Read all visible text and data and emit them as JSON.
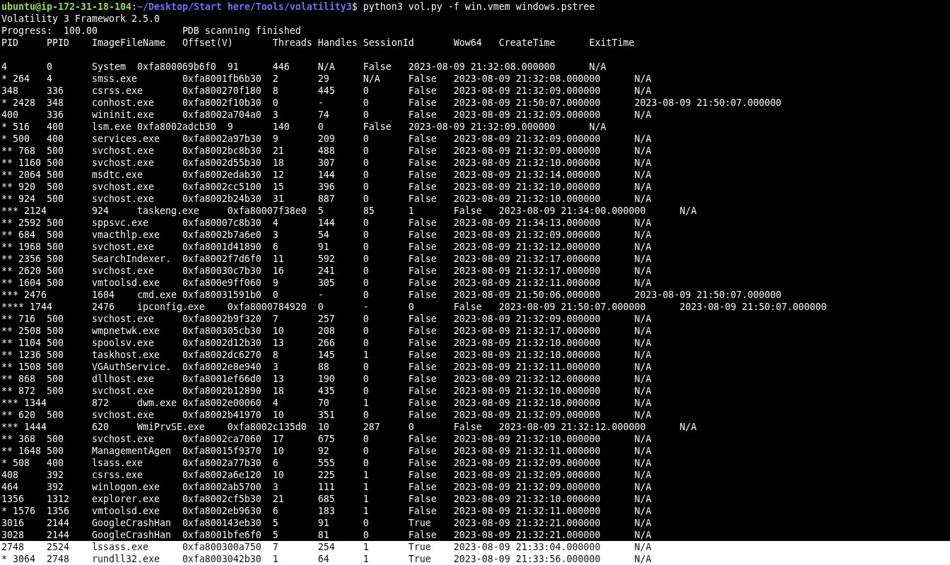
{
  "prompt": {
    "user_host": "ubuntu@ip-172-31-18-104",
    "separator": ":",
    "path": "~/Desktop/Start here/Tools/volatility3",
    "command": "$ python3 vol.py -f win.vmem windows.pstree"
  },
  "banner": "Volatility 3 Framework 2.5.0",
  "progress": [
    "Progress:  100.00",
    "PDB scanning finished"
  ],
  "header": [
    "PID",
    "PPID",
    "ImageFileName",
    "Offset(V)",
    "Threads",
    "Handles",
    "SessionId",
    "Wow64",
    "CreateTime",
    "ExitTime"
  ],
  "rows": [
    {
      "cells": [
        "4",
        "0",
        "System",
        "0xfa800069b6f0",
        "91",
        "446",
        "N/A",
        "False",
        "2023-08-09 21:32:08.000000",
        "N/A"
      ],
      "highlighted": false
    },
    {
      "cells": [
        "* 264",
        "4",
        "smss.exe",
        "0xfa8001fb6b30",
        "2",
        "29",
        "N/A",
        "False",
        "2023-08-09 21:32:08.000000",
        "N/A"
      ],
      "highlighted": false
    },
    {
      "cells": [
        "348",
        "336",
        "csrss.exe",
        "0xfa800270f180",
        "8",
        "445",
        "0",
        "False",
        "2023-08-09 21:32:09.000000",
        "N/A"
      ],
      "highlighted": false
    },
    {
      "cells": [
        "* 2428",
        "348",
        "conhost.exe",
        "0xfa8002f10b30",
        "0",
        "-",
        "0",
        "False",
        "2023-08-09 21:50:07.000000",
        "2023-08-09 21:50:07.000000"
      ],
      "highlighted": false
    },
    {
      "cells": [
        "400",
        "336",
        "wininit.exe",
        "0xfa8002a704a0",
        "3",
        "74",
        "0",
        "False",
        "2023-08-09 21:32:09.000000",
        "N/A"
      ],
      "highlighted": false
    },
    {
      "cells": [
        "* 516",
        "400",
        "lsm.exe",
        "0xfa8002adcb30",
        "9",
        "140",
        "0",
        "False",
        "2023-08-09 21:32:09.000000",
        "N/A"
      ],
      "highlighted": false
    },
    {
      "cells": [
        "* 500",
        "400",
        "services.exe",
        "0xfa8002a97b30",
        "9",
        "209",
        "0",
        "False",
        "2023-08-09 21:32:09.000000",
        "N/A"
      ],
      "highlighted": false
    },
    {
      "cells": [
        "** 768",
        "500",
        "svchost.exe",
        "0xfa8002bc8b30",
        "21",
        "488",
        "0",
        "False",
        "2023-08-09 21:32:09.000000",
        "N/A"
      ],
      "highlighted": false
    },
    {
      "cells": [
        "** 1160",
        "500",
        "svchost.exe",
        "0xfa8002d55b30",
        "18",
        "307",
        "0",
        "False",
        "2023-08-09 21:32:10.000000",
        "N/A"
      ],
      "highlighted": false
    },
    {
      "cells": [
        "** 2064",
        "500",
        "msdtc.exe",
        "0xfa8002edab30",
        "12",
        "144",
        "0",
        "False",
        "2023-08-09 21:32:14.000000",
        "N/A"
      ],
      "highlighted": false
    },
    {
      "cells": [
        "** 920",
        "500",
        "svchost.exe",
        "0xfa8002cc5100",
        "15",
        "396",
        "0",
        "False",
        "2023-08-09 21:32:10.000000",
        "N/A"
      ],
      "highlighted": false
    },
    {
      "cells": [
        "** 924",
        "500",
        "svchost.exe",
        "0xfa8002b24b30",
        "31",
        "887",
        "0",
        "False",
        "2023-08-09 21:32:10.000000",
        "N/A"
      ],
      "highlighted": false
    },
    {
      "cells": [
        "*** 2124",
        "924",
        "taskeng.exe",
        "0xfa80007f38e0",
        "5",
        "85",
        "1",
        "False",
        "2023-08-09 21:34:00.000000",
        "N/A"
      ],
      "highlighted": false
    },
    {
      "cells": [
        "** 2592",
        "500",
        "sppsvc.exe",
        "0xfa80007c8b30",
        "4",
        "144",
        "0",
        "False",
        "2023-08-09 21:34:13.000000",
        "N/A"
      ],
      "highlighted": false
    },
    {
      "cells": [
        "** 684",
        "500",
        "vmacthlp.exe",
        "0xfa8002b7a6e0",
        "3",
        "54",
        "0",
        "False",
        "2023-08-09 21:32:09.000000",
        "N/A"
      ],
      "highlighted": false
    },
    {
      "cells": [
        "** 1968",
        "500",
        "svchost.exe",
        "0xfa8001d41890",
        "6",
        "91",
        "0",
        "False",
        "2023-08-09 21:32:12.000000",
        "N/A"
      ],
      "highlighted": false
    },
    {
      "cells": [
        "** 2356",
        "500",
        "SearchIndexer.",
        "0xfa8002f7d6f0",
        "11",
        "592",
        "0",
        "False",
        "2023-08-09 21:32:17.000000",
        "N/A"
      ],
      "highlighted": false
    },
    {
      "cells": [
        "** 2620",
        "500",
        "svchost.exe",
        "0xfa80030c7b30",
        "16",
        "241",
        "0",
        "False",
        "2023-08-09 21:32:17.000000",
        "N/A"
      ],
      "highlighted": false
    },
    {
      "cells": [
        "** 1604",
        "500",
        "vmtoolsd.exe",
        "0xfa800e9ff060",
        "9",
        "305",
        "0",
        "False",
        "2023-08-09 21:32:11.000000",
        "N/A"
      ],
      "highlighted": false
    },
    {
      "cells": [
        "*** 2476",
        "1604",
        "cmd.exe",
        "0xfa80031591b0",
        "0",
        "-",
        "0",
        "False",
        "2023-08-09 21:50:06.000000",
        "2023-08-09 21:50:07.000000"
      ],
      "highlighted": false
    },
    {
      "cells": [
        "**** 1744",
        "2476",
        "ipconfig.exe",
        "0xfa8000784920",
        "0",
        "-",
        "0",
        "False",
        "2023-08-09 21:50:07.000000",
        "2023-08-09 21:50:07.000000"
      ],
      "highlighted": false
    },
    {
      "cells": [
        "** 716",
        "500",
        "svchost.exe",
        "0xfa8002b9f320",
        "7",
        "257",
        "0",
        "False",
        "2023-08-09 21:32:09.000000",
        "N/A"
      ],
      "highlighted": false
    },
    {
      "cells": [
        "** 2508",
        "500",
        "wmpnetwk.exe",
        "0xfa800305cb30",
        "10",
        "208",
        "0",
        "False",
        "2023-08-09 21:32:17.000000",
        "N/A"
      ],
      "highlighted": false
    },
    {
      "cells": [
        "** 1104",
        "500",
        "spoolsv.exe",
        "0xfa8002d12b30",
        "13",
        "266",
        "0",
        "False",
        "2023-08-09 21:32:10.000000",
        "N/A"
      ],
      "highlighted": false
    },
    {
      "cells": [
        "** 1236",
        "500",
        "taskhost.exe",
        "0xfa8002dc6270",
        "8",
        "145",
        "1",
        "False",
        "2023-08-09 21:32:10.000000",
        "N/A"
      ],
      "highlighted": false
    },
    {
      "cells": [
        "** 1508",
        "500",
        "VGAuthService.",
        "0xfa8002e8e940",
        "3",
        "88",
        "0",
        "False",
        "2023-08-09 21:32:11.000000",
        "N/A"
      ],
      "highlighted": false
    },
    {
      "cells": [
        "** 868",
        "500",
        "dllhost.exe",
        "0xfa8001ef66d0",
        "13",
        "190",
        "0",
        "False",
        "2023-08-09 21:32:12.000000",
        "N/A"
      ],
      "highlighted": false
    },
    {
      "cells": [
        "** 872",
        "500",
        "svchost.exe",
        "0xfa8002b12890",
        "18",
        "435",
        "0",
        "False",
        "2023-08-09 21:32:10.000000",
        "N/A"
      ],
      "highlighted": false
    },
    {
      "cells": [
        "*** 1344",
        "872",
        "dwm.exe",
        "0xfa8002e00060",
        "4",
        "70",
        "1",
        "False",
        "2023-08-09 21:32:10.000000",
        "N/A"
      ],
      "highlighted": false
    },
    {
      "cells": [
        "** 620",
        "500",
        "svchost.exe",
        "0xfa8002b41970",
        "10",
        "351",
        "0",
        "False",
        "2023-08-09 21:32:09.000000",
        "N/A"
      ],
      "highlighted": false
    },
    {
      "cells": [
        "*** 1444",
        "620",
        "WmiPrvSE.exe",
        "0xfa8002c135d0",
        "10",
        "287",
        "0",
        "False",
        "2023-08-09 21:32:12.000000",
        "N/A"
      ],
      "highlighted": false
    },
    {
      "cells": [
        "** 368",
        "500",
        "svchost.exe",
        "0xfa8002ca7060",
        "17",
        "675",
        "0",
        "False",
        "2023-08-09 21:32:10.000000",
        "N/A"
      ],
      "highlighted": false
    },
    {
      "cells": [
        "** 1648",
        "500",
        "ManagementAgen",
        "0xfa80015f9370",
        "10",
        "92",
        "0",
        "False",
        "2023-08-09 21:32:11.000000",
        "N/A"
      ],
      "highlighted": false
    },
    {
      "cells": [
        "* 508",
        "400",
        "lsass.exe",
        "0xfa8002a77b30",
        "6",
        "555",
        "0",
        "False",
        "2023-08-09 21:32:09.000000",
        "N/A"
      ],
      "highlighted": false
    },
    {
      "cells": [
        "408",
        "392",
        "csrss.exe",
        "0xfa8002a6e120",
        "10",
        "225",
        "1",
        "False",
        "2023-08-09 21:32:09.000000",
        "N/A"
      ],
      "highlighted": false
    },
    {
      "cells": [
        "464",
        "392",
        "winlogon.exe",
        "0xfa8002ab5700",
        "3",
        "111",
        "1",
        "False",
        "2023-08-09 21:32:09.000000",
        "N/A"
      ],
      "highlighted": false
    },
    {
      "cells": [
        "1356",
        "1312",
        "explorer.exe",
        "0xfa8002cf5b30",
        "21",
        "685",
        "1",
        "False",
        "2023-08-09 21:32:10.000000",
        "N/A"
      ],
      "highlighted": false
    },
    {
      "cells": [
        "* 1576",
        "1356",
        "vmtoolsd.exe",
        "0xfa8002eb9630",
        "6",
        "183",
        "1",
        "False",
        "2023-08-09 21:32:11.000000",
        "N/A"
      ],
      "highlighted": false
    },
    {
      "cells": [
        "3016",
        "2144",
        "GoogleCrashHan",
        "0xfa800143eb30",
        "5",
        "91",
        "0",
        "True",
        "2023-08-09 21:32:21.000000",
        "N/A"
      ],
      "highlighted": false
    },
    {
      "cells": [
        "3028",
        "2144",
        "GoogleCrashHan",
        "0xfa8001bfe6f0",
        "5",
        "81",
        "0",
        "False",
        "2023-08-09 21:32:21.000000",
        "N/A"
      ],
      "highlighted": false
    },
    {
      "cells": [
        "2748",
        "2524",
        "lssass.exe",
        "0xfa800300a750",
        "7",
        "254",
        "1",
        "True",
        "2023-08-09 21:33:04.000000",
        "N/A"
      ],
      "highlighted": true
    },
    {
      "cells": [
        "* 3064",
        "2748",
        "rundll32.exe",
        "0xfa8003042b30",
        "1",
        "64",
        "1",
        "True",
        "2023-08-09 21:33:56.000000",
        "N/A"
      ],
      "highlighted": true
    }
  ]
}
